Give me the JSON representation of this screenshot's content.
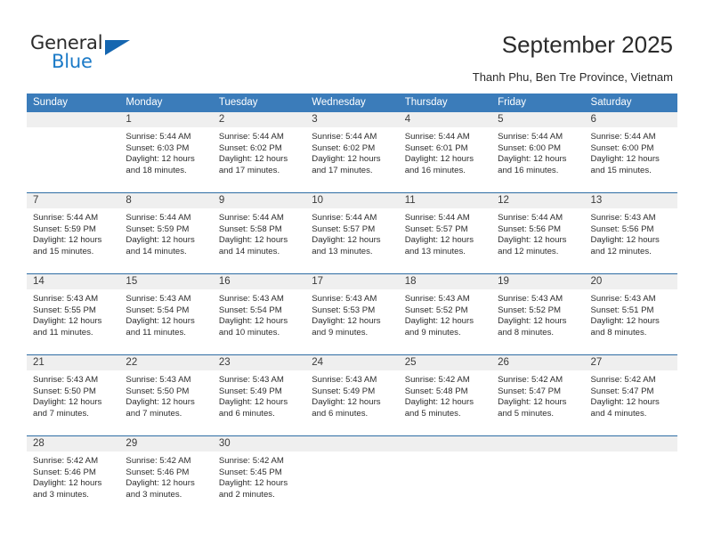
{
  "brand": {
    "name_top": "General",
    "name_bottom": "Blue",
    "logo_icon": "triangle-logo-icon",
    "accent_color": "#1b7ac7"
  },
  "header": {
    "title": "September 2025",
    "subtitle": "Thanh Phu, Ben Tre Province, Vietnam"
  },
  "colors": {
    "header_band": "#3b7cba",
    "row_divider": "#2e6da4",
    "daynum_strip": "#efefef"
  },
  "calendar": {
    "weekday_headers": [
      "Sunday",
      "Monday",
      "Tuesday",
      "Wednesday",
      "Thursday",
      "Friday",
      "Saturday"
    ],
    "weeks": [
      [
        {
          "day": "",
          "blank": true,
          "sunrise": "",
          "sunset": "",
          "daylight_line1": "",
          "daylight_line2": ""
        },
        {
          "day": "1",
          "sunrise": "Sunrise: 5:44 AM",
          "sunset": "Sunset: 6:03 PM",
          "daylight_line1": "Daylight: 12 hours",
          "daylight_line2": "and 18 minutes."
        },
        {
          "day": "2",
          "sunrise": "Sunrise: 5:44 AM",
          "sunset": "Sunset: 6:02 PM",
          "daylight_line1": "Daylight: 12 hours",
          "daylight_line2": "and 17 minutes."
        },
        {
          "day": "3",
          "sunrise": "Sunrise: 5:44 AM",
          "sunset": "Sunset: 6:02 PM",
          "daylight_line1": "Daylight: 12 hours",
          "daylight_line2": "and 17 minutes."
        },
        {
          "day": "4",
          "sunrise": "Sunrise: 5:44 AM",
          "sunset": "Sunset: 6:01 PM",
          "daylight_line1": "Daylight: 12 hours",
          "daylight_line2": "and 16 minutes."
        },
        {
          "day": "5",
          "sunrise": "Sunrise: 5:44 AM",
          "sunset": "Sunset: 6:00 PM",
          "daylight_line1": "Daylight: 12 hours",
          "daylight_line2": "and 16 minutes."
        },
        {
          "day": "6",
          "sunrise": "Sunrise: 5:44 AM",
          "sunset": "Sunset: 6:00 PM",
          "daylight_line1": "Daylight: 12 hours",
          "daylight_line2": "and 15 minutes."
        }
      ],
      [
        {
          "day": "7",
          "sunrise": "Sunrise: 5:44 AM",
          "sunset": "Sunset: 5:59 PM",
          "daylight_line1": "Daylight: 12 hours",
          "daylight_line2": "and 15 minutes."
        },
        {
          "day": "8",
          "sunrise": "Sunrise: 5:44 AM",
          "sunset": "Sunset: 5:59 PM",
          "daylight_line1": "Daylight: 12 hours",
          "daylight_line2": "and 14 minutes."
        },
        {
          "day": "9",
          "sunrise": "Sunrise: 5:44 AM",
          "sunset": "Sunset: 5:58 PM",
          "daylight_line1": "Daylight: 12 hours",
          "daylight_line2": "and 14 minutes."
        },
        {
          "day": "10",
          "sunrise": "Sunrise: 5:44 AM",
          "sunset": "Sunset: 5:57 PM",
          "daylight_line1": "Daylight: 12 hours",
          "daylight_line2": "and 13 minutes."
        },
        {
          "day": "11",
          "sunrise": "Sunrise: 5:44 AM",
          "sunset": "Sunset: 5:57 PM",
          "daylight_line1": "Daylight: 12 hours",
          "daylight_line2": "and 13 minutes."
        },
        {
          "day": "12",
          "sunrise": "Sunrise: 5:44 AM",
          "sunset": "Sunset: 5:56 PM",
          "daylight_line1": "Daylight: 12 hours",
          "daylight_line2": "and 12 minutes."
        },
        {
          "day": "13",
          "sunrise": "Sunrise: 5:43 AM",
          "sunset": "Sunset: 5:56 PM",
          "daylight_line1": "Daylight: 12 hours",
          "daylight_line2": "and 12 minutes."
        }
      ],
      [
        {
          "day": "14",
          "sunrise": "Sunrise: 5:43 AM",
          "sunset": "Sunset: 5:55 PM",
          "daylight_line1": "Daylight: 12 hours",
          "daylight_line2": "and 11 minutes."
        },
        {
          "day": "15",
          "sunrise": "Sunrise: 5:43 AM",
          "sunset": "Sunset: 5:54 PM",
          "daylight_line1": "Daylight: 12 hours",
          "daylight_line2": "and 11 minutes."
        },
        {
          "day": "16",
          "sunrise": "Sunrise: 5:43 AM",
          "sunset": "Sunset: 5:54 PM",
          "daylight_line1": "Daylight: 12 hours",
          "daylight_line2": "and 10 minutes."
        },
        {
          "day": "17",
          "sunrise": "Sunrise: 5:43 AM",
          "sunset": "Sunset: 5:53 PM",
          "daylight_line1": "Daylight: 12 hours",
          "daylight_line2": "and 9 minutes."
        },
        {
          "day": "18",
          "sunrise": "Sunrise: 5:43 AM",
          "sunset": "Sunset: 5:52 PM",
          "daylight_line1": "Daylight: 12 hours",
          "daylight_line2": "and 9 minutes."
        },
        {
          "day": "19",
          "sunrise": "Sunrise: 5:43 AM",
          "sunset": "Sunset: 5:52 PM",
          "daylight_line1": "Daylight: 12 hours",
          "daylight_line2": "and 8 minutes."
        },
        {
          "day": "20",
          "sunrise": "Sunrise: 5:43 AM",
          "sunset": "Sunset: 5:51 PM",
          "daylight_line1": "Daylight: 12 hours",
          "daylight_line2": "and 8 minutes."
        }
      ],
      [
        {
          "day": "21",
          "sunrise": "Sunrise: 5:43 AM",
          "sunset": "Sunset: 5:50 PM",
          "daylight_line1": "Daylight: 12 hours",
          "daylight_line2": "and 7 minutes."
        },
        {
          "day": "22",
          "sunrise": "Sunrise: 5:43 AM",
          "sunset": "Sunset: 5:50 PM",
          "daylight_line1": "Daylight: 12 hours",
          "daylight_line2": "and 7 minutes."
        },
        {
          "day": "23",
          "sunrise": "Sunrise: 5:43 AM",
          "sunset": "Sunset: 5:49 PM",
          "daylight_line1": "Daylight: 12 hours",
          "daylight_line2": "and 6 minutes."
        },
        {
          "day": "24",
          "sunrise": "Sunrise: 5:43 AM",
          "sunset": "Sunset: 5:49 PM",
          "daylight_line1": "Daylight: 12 hours",
          "daylight_line2": "and 6 minutes."
        },
        {
          "day": "25",
          "sunrise": "Sunrise: 5:42 AM",
          "sunset": "Sunset: 5:48 PM",
          "daylight_line1": "Daylight: 12 hours",
          "daylight_line2": "and 5 minutes."
        },
        {
          "day": "26",
          "sunrise": "Sunrise: 5:42 AM",
          "sunset": "Sunset: 5:47 PM",
          "daylight_line1": "Daylight: 12 hours",
          "daylight_line2": "and 5 minutes."
        },
        {
          "day": "27",
          "sunrise": "Sunrise: 5:42 AM",
          "sunset": "Sunset: 5:47 PM",
          "daylight_line1": "Daylight: 12 hours",
          "daylight_line2": "and 4 minutes."
        }
      ],
      [
        {
          "day": "28",
          "sunrise": "Sunrise: 5:42 AM",
          "sunset": "Sunset: 5:46 PM",
          "daylight_line1": "Daylight: 12 hours",
          "daylight_line2": "and 3 minutes."
        },
        {
          "day": "29",
          "sunrise": "Sunrise: 5:42 AM",
          "sunset": "Sunset: 5:46 PM",
          "daylight_line1": "Daylight: 12 hours",
          "daylight_line2": "and 3 minutes."
        },
        {
          "day": "30",
          "sunrise": "Sunrise: 5:42 AM",
          "sunset": "Sunset: 5:45 PM",
          "daylight_line1": "Daylight: 12 hours",
          "daylight_line2": "and 2 minutes."
        },
        {
          "day": "",
          "blank": true,
          "sunrise": "",
          "sunset": "",
          "daylight_line1": "",
          "daylight_line2": ""
        },
        {
          "day": "",
          "blank": true,
          "sunrise": "",
          "sunset": "",
          "daylight_line1": "",
          "daylight_line2": ""
        },
        {
          "day": "",
          "blank": true,
          "sunrise": "",
          "sunset": "",
          "daylight_line1": "",
          "daylight_line2": ""
        },
        {
          "day": "",
          "blank": true,
          "sunrise": "",
          "sunset": "",
          "daylight_line1": "",
          "daylight_line2": ""
        }
      ]
    ]
  }
}
